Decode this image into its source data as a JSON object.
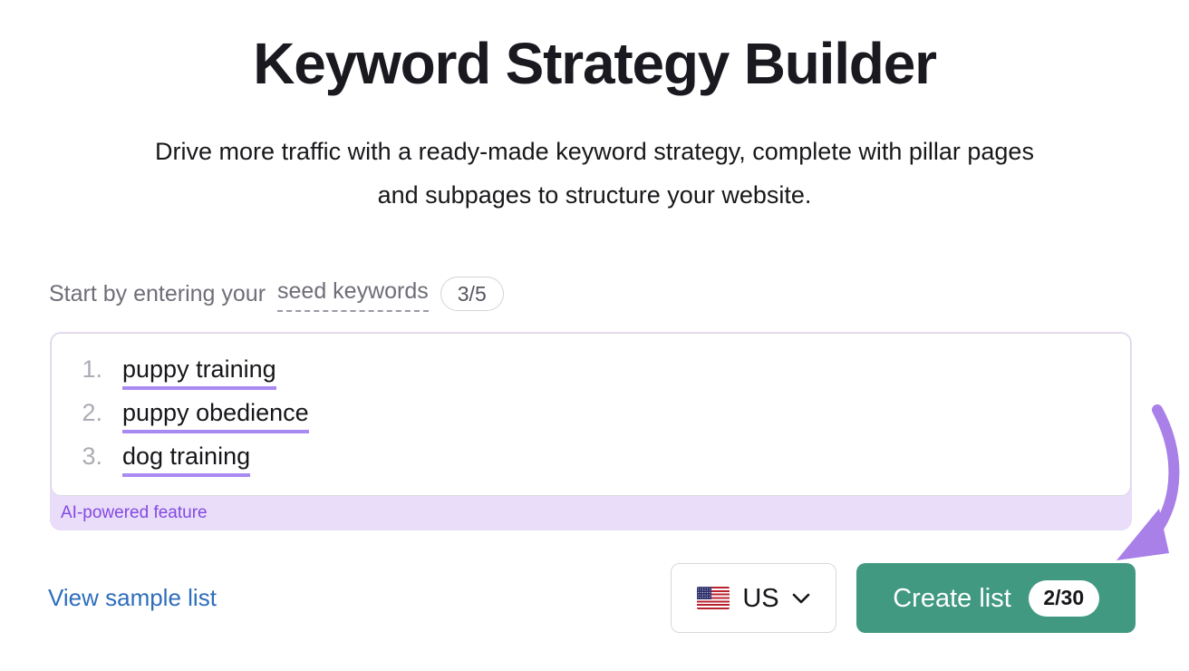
{
  "header": {
    "title": "Keyword Strategy Builder",
    "subtitle": "Drive more traffic with a ready-made keyword strategy, complete with pillar pages and subpages to structure your website."
  },
  "prompt": {
    "lead_text": "Start by entering your",
    "seed_link_label": "seed keywords",
    "seed_count": "3/5"
  },
  "keyword_input": {
    "keywords": [
      {
        "number": "1.",
        "text": "puppy training"
      },
      {
        "number": "2.",
        "text": "puppy obedience"
      },
      {
        "number": "3.",
        "text": "dog training"
      }
    ],
    "ai_note": "AI-powered feature"
  },
  "footer": {
    "sample_link_label": "View sample list",
    "country": {
      "flag_icon": "us-flag-icon",
      "label": "US",
      "chevron_icon": "chevron-down-icon"
    },
    "create_button": {
      "label": "Create list",
      "badge": "2/30"
    }
  },
  "annotation": {
    "arrow_icon": "curved-arrow-icon"
  },
  "colors": {
    "title": "#19191F",
    "accent_purple": "#A98AF2",
    "ai_note_text": "#8449E0",
    "ai_note_bg": "#E9DDFA",
    "link_blue": "#2E6EBC",
    "button_green": "#419981",
    "muted_gray": "#6E6E78"
  }
}
